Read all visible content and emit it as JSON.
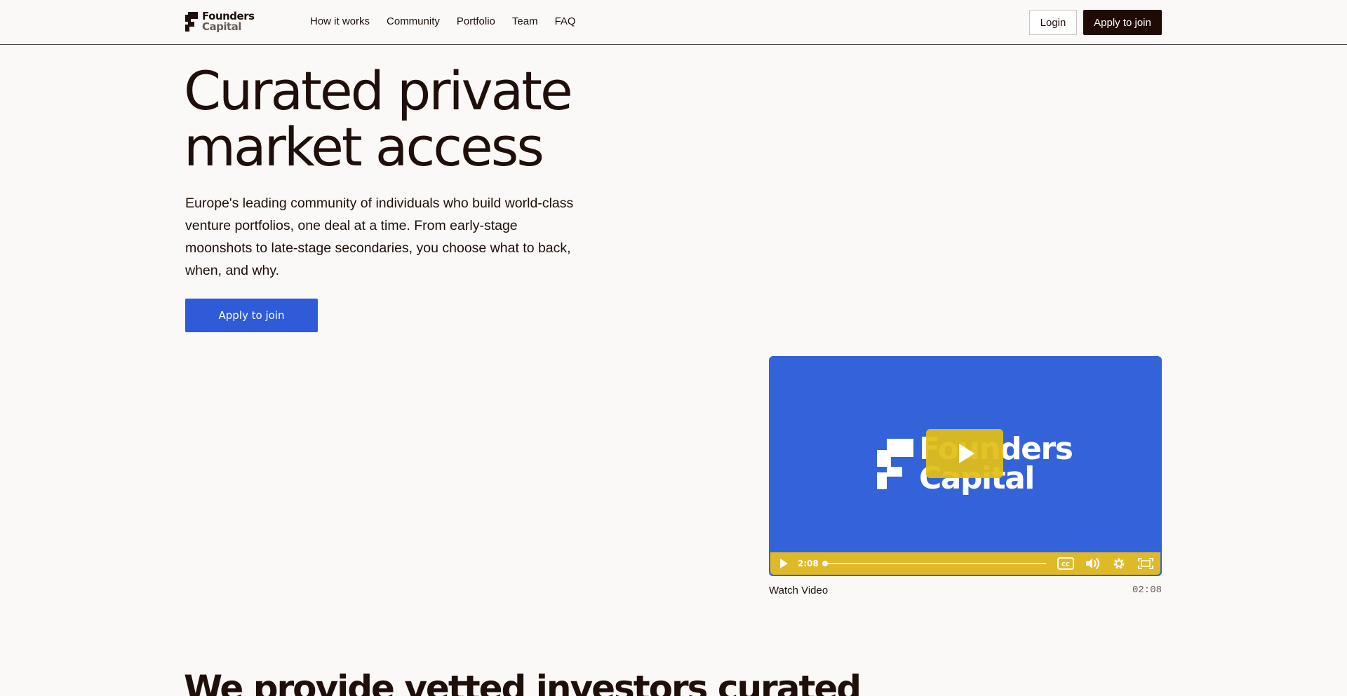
{
  "header": {
    "logo": {
      "line1": "Founders",
      "line2": "Capital"
    },
    "nav": [
      {
        "label": "How it works"
      },
      {
        "label": "Community"
      },
      {
        "label": "Portfolio"
      },
      {
        "label": "Team"
      },
      {
        "label": "FAQ"
      }
    ],
    "login_label": "Login",
    "apply_label": "Apply to join"
  },
  "hero": {
    "title_line1": "Curated private",
    "title_line2": "market access",
    "description": "Europe's leading community of individuals who build world-class venture portfolios, one deal at a time. From early-stage moonshots to late-stage secondaries, you choose what to back, when, and why.",
    "cta_label": "Apply to join"
  },
  "video": {
    "logo_line1": "Founders",
    "logo_line2": "Capital",
    "current_time": "2:08",
    "progress": 0,
    "caption": "Watch Video",
    "duration": "02:08",
    "background_color": "#3463d9",
    "controls_color": "#e0b928"
  },
  "section2": {
    "title": "We provide vetted investors curated"
  },
  "colors": {
    "text": "#1f0f0a",
    "primary_blue": "#2f5bd9",
    "dark_button": "#1f0a05",
    "page_bg": "#faf9f7"
  }
}
